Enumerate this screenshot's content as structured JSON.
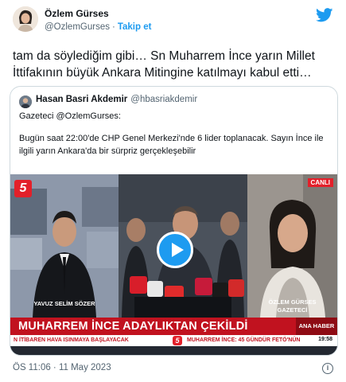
{
  "author": {
    "name": "Özlem Gürses",
    "handle": "@OzlemGurses",
    "separator": "·",
    "follow_label": "Takip et"
  },
  "tweet": {
    "text": "tam da söylediğim gibi… Sn Muharrem İnce yarın Millet İttifakının büyük Ankara Mitingine katılmayı kabul etti…"
  },
  "quoted": {
    "name": "Hasan Basri Akdemir",
    "handle": "@hbasriakdemir",
    "line1": "Gazeteci @OzlemGurses:",
    "line2": "Bugün saat 22:00'de CHP Genel Merkezi'nde 6 lider toplanacak. Sayın İnce ile ilgili yarın Ankara'da bir sürpriz gerçekleşebilir"
  },
  "video": {
    "channel_logo": "5",
    "live_label": "CANLI",
    "caption_left": "YAVUZ SELİM SÖZER",
    "caption_right_name": "ÖZLEM GÜRSES",
    "caption_right_title": "GAZETECİ",
    "banner": "MUHARREM İNCE ADAYLIKTAN ÇEKİLDİ",
    "banner_tag": "ANA HABER",
    "ticker_left": "N İTİBAREN HAVA ISINMAYA BAŞLAYACAK",
    "ticker_right": "MUHARREM İNCE: 45 GÜNDÜR FETÖ'NÜN",
    "ticker_time": "19:58",
    "play_icon": "play-icon"
  },
  "footer": {
    "timestamp": "ÖS 11:06 · 11 May 2023",
    "info_icon": "i"
  },
  "colors": {
    "twitter_blue": "#1d9bf0",
    "text": "#0f1419",
    "muted": "#536471",
    "news_red": "#c1121f"
  }
}
